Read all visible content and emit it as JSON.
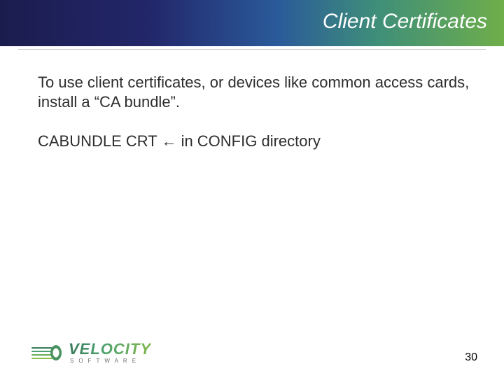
{
  "title": "Client Certificates",
  "body": {
    "p1": "To use client certificates, or devices like common access cards, install a “CA bundle”.",
    "p2": "CABUNDLE CRT ← in CONFIG directory"
  },
  "page_number": "30",
  "logo": {
    "word": "VELOCITY",
    "sub": "SOFTWARE"
  }
}
